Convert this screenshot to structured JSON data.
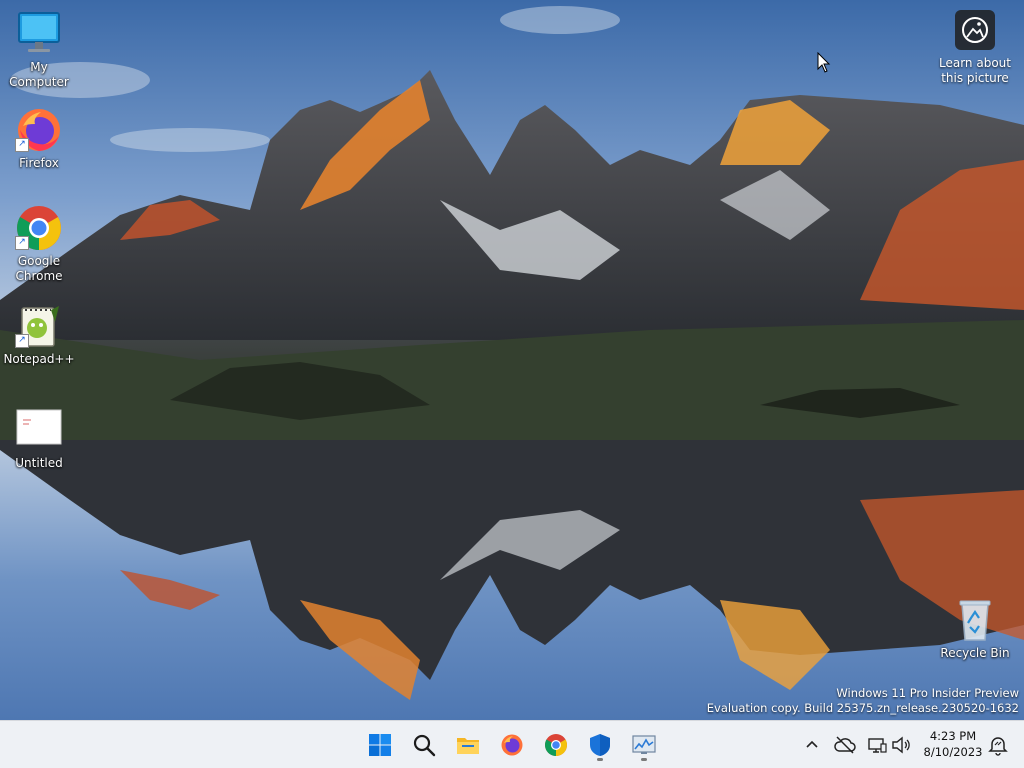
{
  "desktop": {
    "icons": [
      {
        "id": "my-computer",
        "label": "My Computer",
        "icon": "monitor-icon"
      },
      {
        "id": "firefox",
        "label": "Firefox",
        "icon": "firefox-icon"
      },
      {
        "id": "chrome",
        "label": "Google Chrome",
        "icon": "chrome-icon"
      },
      {
        "id": "notepadpp",
        "label": "Notepad++",
        "icon": "notepadpp-icon"
      },
      {
        "id": "untitled",
        "label": "Untitled",
        "icon": "image-file-icon"
      },
      {
        "id": "recycle-bin",
        "label": "Recycle Bin",
        "icon": "recycle-bin-icon"
      }
    ],
    "learn_about": {
      "line1": "Learn about",
      "line2": "this picture",
      "icon": "camera-spotlight-icon"
    },
    "watermark": {
      "line1": "Windows 11 Pro Insider Preview",
      "line2": "Evaluation copy. Build 25375.zn_release.230520-1632"
    }
  },
  "taskbar": {
    "pinned": [
      {
        "id": "start",
        "icon": "windows-start-icon"
      },
      {
        "id": "search",
        "icon": "search-icon"
      },
      {
        "id": "file-explorer",
        "icon": "folder-icon"
      },
      {
        "id": "firefox",
        "icon": "firefox-icon"
      },
      {
        "id": "chrome",
        "icon": "chrome-icon"
      },
      {
        "id": "defender",
        "icon": "shield-icon",
        "running": true
      },
      {
        "id": "resource-monitor",
        "icon": "monitor-graph-icon",
        "running": true
      }
    ],
    "tray": {
      "icons": [
        "chevron-up-icon",
        "cloud-off-icon",
        "network-icon",
        "speaker-icon"
      ],
      "time": "4:23 PM",
      "date": "8/10/2023",
      "notification_icon": "notification-dnd-icon"
    }
  },
  "colors": {
    "taskbar_bg": "#eef1f5",
    "accent": "#0067c0"
  }
}
